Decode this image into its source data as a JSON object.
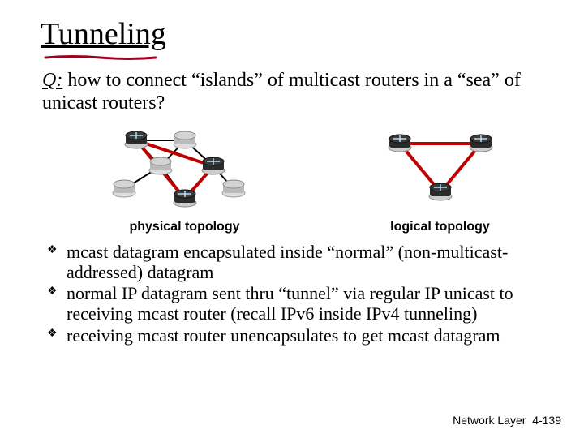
{
  "title": "Tunneling",
  "question_prefix": "Q:",
  "question_text": " how to connect “islands” of multicast  routers in a “sea” of unicast routers?",
  "captions": {
    "physical": "physical topology",
    "logical": "logical topology"
  },
  "bullets": [
    "mcast datagram encapsulated inside “normal” (non-multicast-addressed) datagram",
    "normal IP datagram sent thru “tunnel” via regular IP unicast to receiving mcast router (recall IPv6 inside IPv4 tunneling)",
    "receiving mcast router unencapsulates to get mcast datagram"
  ],
  "footer": {
    "section": "Network Layer",
    "page": "4-139"
  },
  "colors": {
    "tunnel_line": "#c00000",
    "edge_line": "#000000",
    "router_base_stroke": "#808080",
    "router_body": "#303030",
    "underline": "#a00020"
  }
}
